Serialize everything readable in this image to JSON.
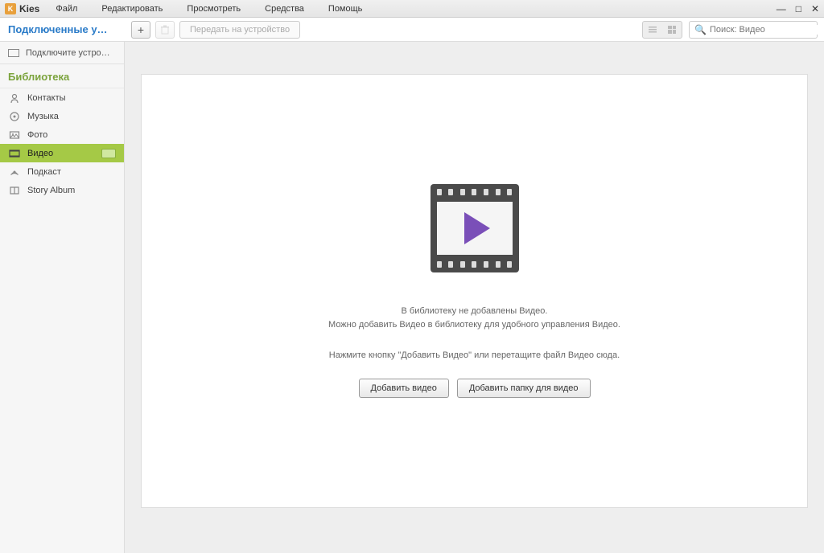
{
  "app": {
    "title": "Kies",
    "logo_letter": "K"
  },
  "menu": {
    "file": "Файл",
    "edit": "Редактировать",
    "view": "Просмотреть",
    "tools": "Средства",
    "help": "Помощь"
  },
  "header": {
    "connected": "Подключенные у…"
  },
  "toolbar": {
    "transfer": "Передать на устройство"
  },
  "search": {
    "placeholder": "Поиск: Видео"
  },
  "sidebar": {
    "connect": "Подключите устро…",
    "library": "Библиотека",
    "items": [
      {
        "label": "Контакты"
      },
      {
        "label": "Музыка"
      },
      {
        "label": "Фото"
      },
      {
        "label": "Видео"
      },
      {
        "label": "Подкаст"
      },
      {
        "label": "Story Album"
      }
    ]
  },
  "empty": {
    "line1": "В библиотеку не добавлены Видео.",
    "line2": "Можно добавить Видео в библиотеку для удобного управления Видео.",
    "line3": "Нажмите кнопку \"Добавить Видео\" или перетащите файл Видео сюда.",
    "add_video": "Добавить видео",
    "add_folder": "Добавить папку для видео"
  }
}
